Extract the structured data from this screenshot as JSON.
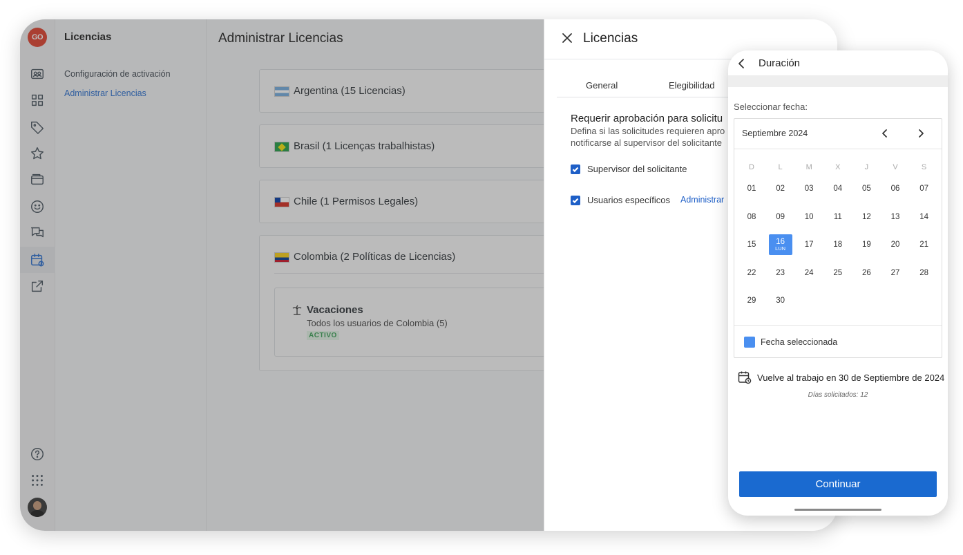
{
  "app": {
    "logo_text": "GO",
    "brand_color": "#e0402e",
    "accent_color": "#1e5fc7"
  },
  "rail": {
    "icons": [
      "users-icon",
      "grid-icon",
      "tag-icon",
      "star-icon",
      "wallet-icon",
      "smile-icon",
      "chat-icon",
      "calendar-icon",
      "external-link-icon"
    ],
    "bottom_icons": [
      "help-icon",
      "apps-icon"
    ],
    "active": "calendar-icon"
  },
  "subnav": {
    "title": "Licencias",
    "items": [
      {
        "label": "Configuración de activación"
      },
      {
        "label": "Administrar Licencias"
      }
    ]
  },
  "main": {
    "title": "Administrar Licencias",
    "countries": [
      {
        "name": "Argentina (15 Licencias)"
      },
      {
        "name": "Brasil (1 Licenças trabalhistas)"
      },
      {
        "name": "Chile (1 Permisos Legales)"
      },
      {
        "name": "Colombia (2 Políticas de Licencias)"
      }
    ],
    "policy": {
      "title": "Vacaciones",
      "subtitle": "Todos los usuarios de Colombia (5)",
      "status": "ACTIVO"
    }
  },
  "drawer": {
    "title": "Licencias",
    "tabs": [
      {
        "label": "General"
      },
      {
        "label": "Elegibilidad"
      }
    ],
    "section_title": "Requerir aprobación para solicitu",
    "section_desc_1": "Defina si las solicitudes requieren apro",
    "section_desc_2": "notificarse al supervisor del solicitante",
    "checks": [
      {
        "label": "Supervisor del solicitante",
        "checked": true
      },
      {
        "label": "Usuarios específicos",
        "checked": true
      }
    ],
    "manage_link": "Administrar"
  },
  "phone": {
    "title": "Duración",
    "select_label": "Seleccionar fecha:",
    "month": "Septiembre 2024",
    "weekdays": [
      "D",
      "L",
      "M",
      "X",
      "J",
      "V",
      "S"
    ],
    "days": [
      [
        "01",
        "02",
        "03",
        "04",
        "05",
        "06",
        "07"
      ],
      [
        "08",
        "09",
        "10",
        "11",
        "12",
        "13",
        "14"
      ],
      [
        "15",
        "16",
        "17",
        "18",
        "19",
        "20",
        "21"
      ],
      [
        "22",
        "23",
        "24",
        "25",
        "26",
        "27",
        "28"
      ],
      [
        "29",
        "30",
        "",
        "",
        "",
        "",
        ""
      ]
    ],
    "selected_day": "16",
    "selected_day_sub": "LUN",
    "legend": "Fecha seleccionada",
    "selected_color": "#4a8ff0",
    "return_text": "Vuelve al trabajo en 30 de Septiembre de 2024",
    "days_requested": "Días solicitados: 12",
    "continue_label": "Continuar"
  }
}
